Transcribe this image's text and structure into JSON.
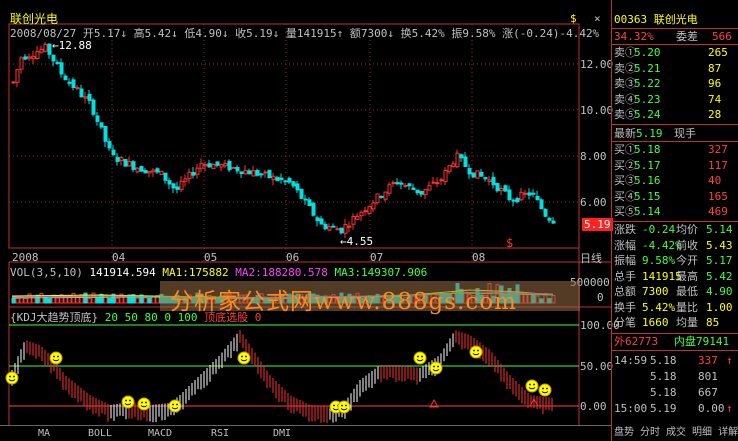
{
  "stock": {
    "name": "联创光电",
    "code_name": "00363 联创光电"
  },
  "info_bar": {
    "date": "2008/08/27",
    "items": [
      "开5.17↓",
      "高5.42↓",
      "低4.90↓",
      "收5.19↓",
      "量141915↑",
      "额7300↓",
      "换5.42%",
      "振9.58%",
      "涨(-0.24)-4.42%"
    ]
  },
  "price_axis": [
    "12.00",
    "10.00",
    "8.00",
    "6.00"
  ],
  "current_price": "5.19",
  "annotations": {
    "high": "12.88",
    "low": "4.55"
  },
  "time_axis": [
    "2008",
    "04",
    "05",
    "06",
    "07",
    "08"
  ],
  "period_label": "日线",
  "vol_header": {
    "label": "VOL(3,5,10)",
    "value": "141914.594",
    "ma1": "MA1:175882",
    "ma2": "MA2:188280.578",
    "ma3": "MA3:149307.906"
  },
  "vol_axis": [
    "500000",
    "0"
  ],
  "kdj_header": {
    "label": "{KDJ大趋势顶底}",
    "params": "20 50 80 0 100",
    "signal": "顶底选股 0"
  },
  "kdj_axis": [
    "100.00",
    "50.00",
    "0.00"
  ],
  "watermark": "分析家公式网www.888gs.com",
  "tabs": [
    "MA",
    "BOLL",
    "MACD",
    "RSI",
    "DMI"
  ],
  "right_panel": {
    "ratio_label": "委比",
    "ratio_value": "34.32%",
    "diff_label": "委差",
    "diff_value": "566",
    "sell": [
      {
        "label": "卖⑤",
        "price": "5.24",
        "vol": "28"
      },
      {
        "label": "卖④",
        "price": "5.23",
        "vol": "74"
      },
      {
        "label": "卖③",
        "price": "5.22",
        "vol": "96"
      },
      {
        "label": "卖②",
        "price": "5.21",
        "vol": "87"
      },
      {
        "label": "卖①",
        "price": "5.20",
        "vol": "265"
      }
    ],
    "latest_label": "最新",
    "latest_value": "5.19",
    "hand_label": "现手",
    "buy": [
      {
        "label": "买①",
        "price": "5.18",
        "vol": "327"
      },
      {
        "label": "买②",
        "price": "5.17",
        "vol": "117"
      },
      {
        "label": "买③",
        "price": "5.16",
        "vol": "40"
      },
      {
        "label": "买④",
        "price": "5.15",
        "vol": "165"
      },
      {
        "label": "买⑤",
        "price": "5.14",
        "vol": "469"
      }
    ],
    "stats": [
      {
        "l1": "涨跌",
        "v1": "-0.24",
        "l2": "均价",
        "v2": "5.14"
      },
      {
        "l1": "涨幅",
        "v1": "-4.42%",
        "l2": "前收",
        "v2": "5.43"
      },
      {
        "l1": "振幅",
        "v1": "9.58%",
        "l2": "今开",
        "v2": "5.17"
      },
      {
        "l1": "总手",
        "v1": "141915",
        "l2": "最高",
        "v2": "5.42"
      },
      {
        "l1": "总额",
        "v1": "7300",
        "l2": "最低",
        "v2": "4.90"
      },
      {
        "l1": "换手",
        "v1": "5.42%",
        "l2": "量比",
        "v2": "1.00"
      },
      {
        "l1": "分笔",
        "v1": "1660",
        "l2": "均量",
        "v2": "85"
      }
    ],
    "outer": "外62773",
    "inner": "内盘79141",
    "ticks": [
      {
        "time": "14:59",
        "price": "5.18",
        "vol": "337",
        "dir": "↑"
      },
      {
        "time": "",
        "price": "5.18",
        "vol": "801",
        "dir": ""
      },
      {
        "time": "",
        "price": "5.18",
        "vol": "667",
        "dir": ""
      },
      {
        "time": "15:00",
        "price": "5.19",
        "vol": "0.00",
        "dir": "↑"
      }
    ],
    "footer": "盘势 分时 成交 明细 详解"
  }
}
